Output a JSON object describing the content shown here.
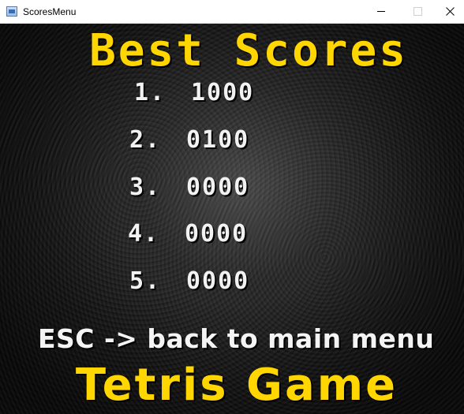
{
  "window": {
    "title": "ScoresMenu",
    "app_icon": "window-app-icon",
    "controls": [
      "minimize-icon",
      "maximize-icon",
      "close-icon"
    ]
  },
  "screen": {
    "heading": "Best Scores",
    "scores": [
      {
        "rank": "1.",
        "value": "1000"
      },
      {
        "rank": "2.",
        "value": "0100"
      },
      {
        "rank": "3.",
        "value": "0000"
      },
      {
        "rank": "4.",
        "value": "0000"
      },
      {
        "rank": "5.",
        "value": "0000"
      }
    ],
    "hint": "ESC -> back to main menu",
    "footer_title": "Tetris Game"
  },
  "colors": {
    "heading": "#ffd600",
    "score_text": "#f2f2f2",
    "background": "#0c0c0c"
  }
}
